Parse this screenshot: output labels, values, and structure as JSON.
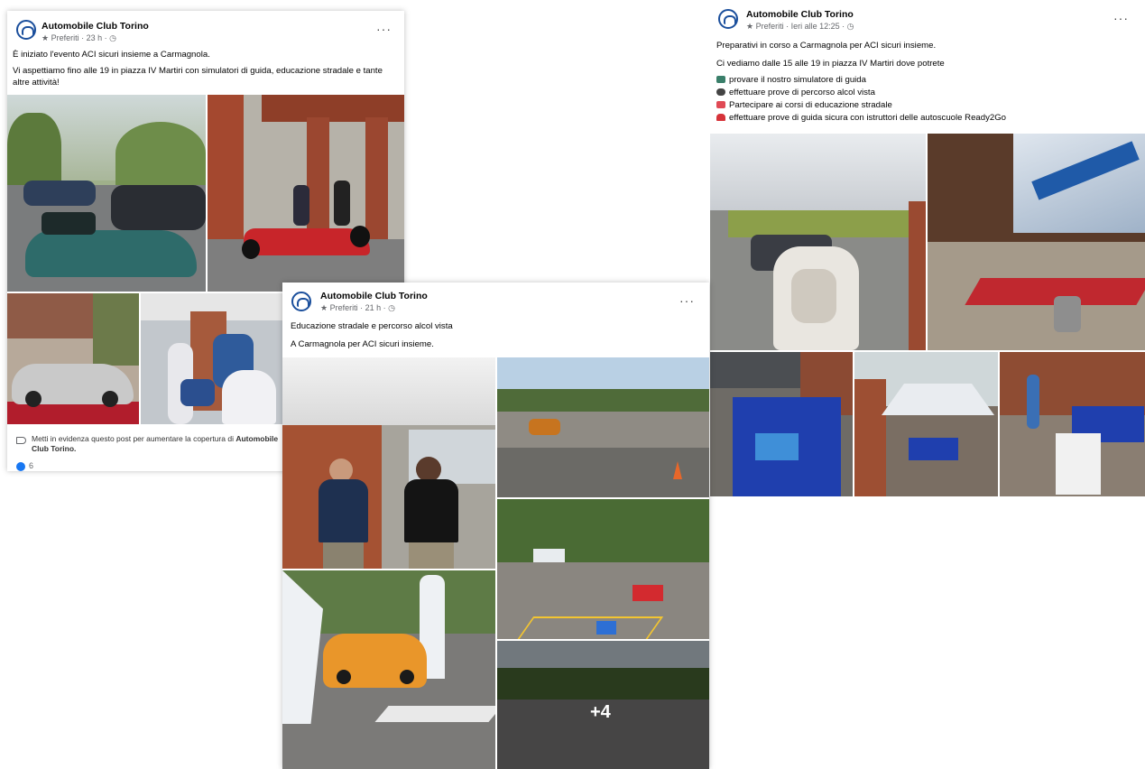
{
  "post1": {
    "author": "Automobile Club Torino",
    "meta": "★ Preferiti · 23 h · ◷",
    "more": "···",
    "line1": "È iniziato l'evento ACI sicuri insieme a Carmagnola.",
    "line2a": "Vi aspettiamo fino alle 19 in piazza IV Martiri con simulatori di guida, educazione stradale e tante",
    "line2b": "altre attività!",
    "boost_text_a": "Metti in evidenza questo post per aumentare la copertura di",
    "boost_bold": "Automobile",
    "boost_text_b": "Club Torino.",
    "likes": "6"
  },
  "post2": {
    "author": "Automobile Club Torino",
    "meta": "★ Preferiti · 21 h · ◷",
    "more": "···",
    "line1": "Educazione stradale e percorso alcol vista",
    "line2": "A Carmagnola per ACI sicuri insieme.",
    "more_photos": "+4"
  },
  "post3": {
    "author": "Automobile Club Torino",
    "meta": "★ Preferiti · Ieri alle 12:25 · ◷",
    "more": "···",
    "line1": "Preparativi in corso a Carmagnola per ACI sicuri insieme.",
    "line2": "Ci vediamo dalle 15 alle 19 in piazza IV Martiri dove potrete",
    "bullets": [
      "provare il nostro simulatore di guida",
      "effettuare prove di percorso alcol vista",
      "Partecipare ai corsi di educazione stradale",
      "effettuare prove di guida sicura con istruttori delle autoscuole Ready2Go"
    ],
    "bullet_icons": [
      "monitor-icon",
      "eyes-icon",
      "book-icon",
      "car-icon"
    ]
  },
  "colors": {
    "like": "#1877f2",
    "brand": "#1b4f9c"
  }
}
